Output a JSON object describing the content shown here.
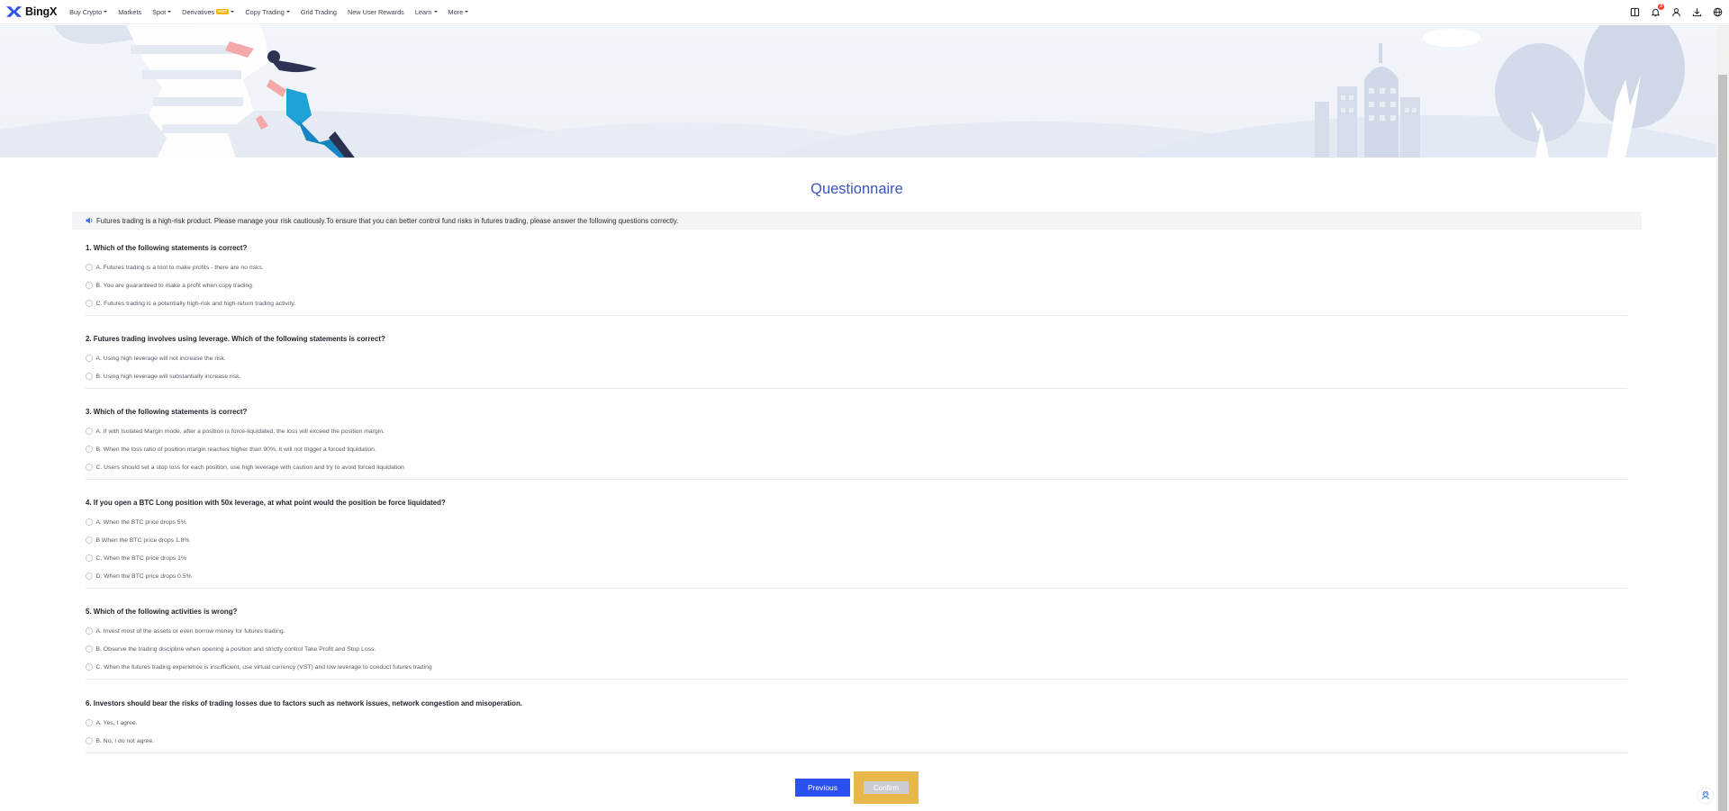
{
  "brand": {
    "name": "BingX",
    "logo_icon": "bingx-x-logo-icon",
    "accent": "#2b4ff0"
  },
  "nav": {
    "items": [
      {
        "label": "Buy Crypto",
        "dropdown": true
      },
      {
        "label": "Markets",
        "dropdown": false
      },
      {
        "label": "Spot",
        "dropdown": true
      },
      {
        "label": "Derivatives",
        "dropdown": true,
        "badge": "HOT"
      },
      {
        "label": "Copy Trading",
        "dropdown": true
      },
      {
        "label": "Grid Trading",
        "dropdown": false
      },
      {
        "label": "New User Rewards",
        "dropdown": false
      },
      {
        "label": "Learn",
        "dropdown": true
      },
      {
        "label": "More",
        "dropdown": true
      }
    ],
    "right_icons": [
      "orders-icon",
      "bell-icon",
      "user-icon",
      "download-icon",
      "globe-icon"
    ],
    "notification_count": "3"
  },
  "page": {
    "title": "Questionnaire",
    "notice": "Futures trading is a high-risk product. Please manage your risk cautiously.To ensure that you can better control fund risks in futures trading, please answer the following questions correctly."
  },
  "questions": [
    {
      "text": "1. Which of the following statements is correct?",
      "options": [
        "A. Futures trading is a tool to make profits - there are no risks.",
        "B. You are guaranteed to make a profit when copy trading.",
        "C. Futures trading is a potentially high-risk and high-return trading activity."
      ]
    },
    {
      "text": "2. Futures trading involves using leverage. Which of the following statements is correct?",
      "options": [
        "A. Using high leverage will not increase the risk.",
        "B. Using high leverage will substantially increase risk."
      ]
    },
    {
      "text": "3. Which of the following statements is correct?",
      "options": [
        "A. If with Isolated Margin mode, after a position is force-liquidated, the loss will exceed the position margin.",
        "B. When the loss ratio of position margin reaches higher than 90%, it will not trigger a forced liquidation.",
        "C. Users should set a stop loss for each position, use high leverage with caution and try to avoid forced liquidation"
      ]
    },
    {
      "text": "4. If you open a BTC Long position with 50x leverage, at what point would the position be force liquidated?",
      "options": [
        "A. When the BTC price drops 5%",
        "B When the BTC price drops 1.8%",
        "C. When the BTC price drops 1%",
        "D. When the BTC price drops 0.5%"
      ]
    },
    {
      "text": "5. Which of the following activities is wrong?",
      "options": [
        "A. Invest most of the assets or even borrow money for futures trading.",
        "B. Observe the trading discipline when opening a position and strictly control Take Profit and Stop Loss.",
        "C. When the futures trading experience is insufficient, use virtual currency (VST) and low leverage to conduct futures trading"
      ]
    },
    {
      "text": "6. Investors should bear the risks of trading losses due to factors such as network issues, network congestion and misoperation.",
      "options": [
        "A. Yes, I agree.",
        "B. No, I do not agree."
      ]
    }
  ],
  "actions": {
    "previous_label": "Previous",
    "confirm_label": "Confirm"
  }
}
